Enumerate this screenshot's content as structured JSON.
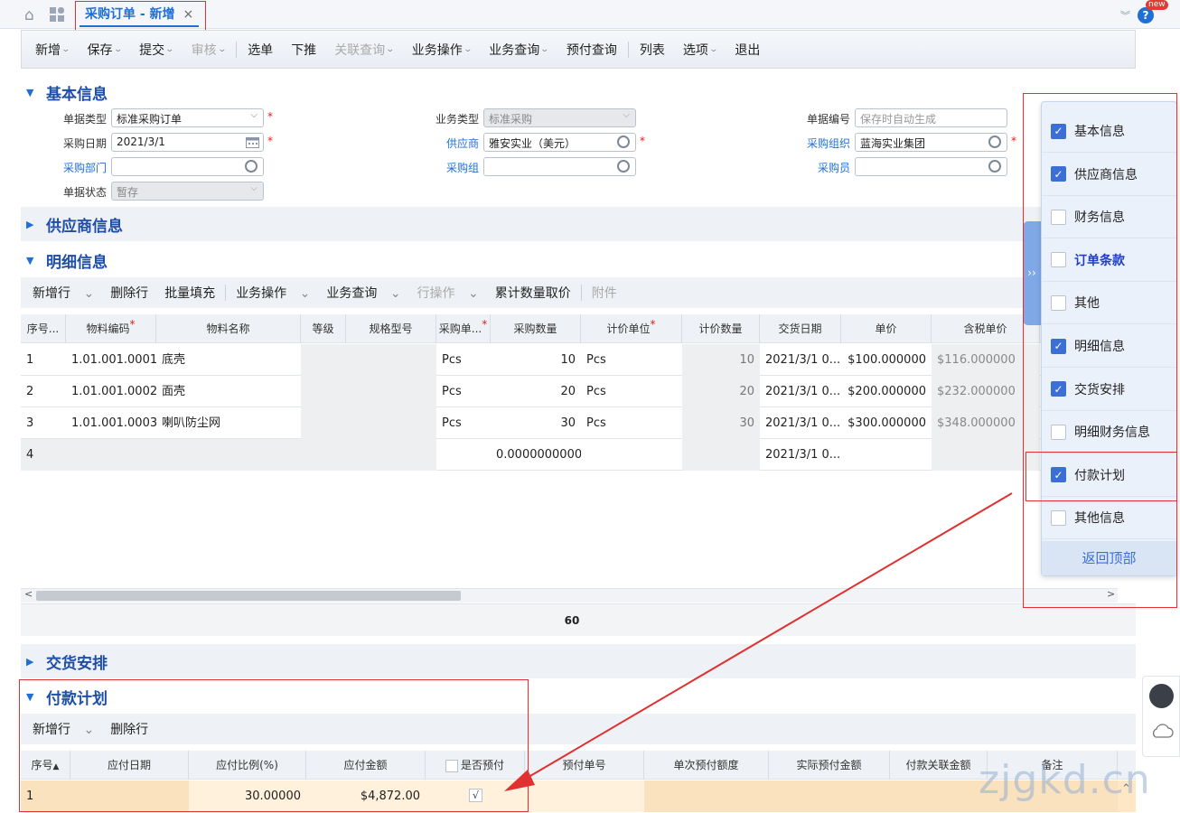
{
  "tab": {
    "title": "采购订单 - 新增",
    "close": "×"
  },
  "badge": "new",
  "toolbar": [
    "新增",
    "保存",
    "提交",
    "审核",
    "选单",
    "下推",
    "关联查询",
    "业务操作",
    "业务查询",
    "预付查询",
    "列表",
    "选项",
    "退出"
  ],
  "sections": {
    "basic": "基本信息",
    "supplier": "供应商信息",
    "detail": "明细信息",
    "delivery": "交货安排",
    "payment": "付款计划"
  },
  "form": {
    "bill_type_label": "单据类型",
    "bill_type": "标准采购订单",
    "biz_type_label": "业务类型",
    "biz_type": "标准采购",
    "bill_no_label": "单据编号",
    "bill_no_ph": "保存时自动生成",
    "date_label": "采购日期",
    "date": "2021/3/1",
    "supplier_label": "供应商",
    "supplier": "雅安实业（美元）",
    "org_label": "采购组织",
    "org": "蓝海实业集团",
    "dept_label": "采购部门",
    "group_label": "采购组",
    "buyer_label": "采购员",
    "status_label": "单据状态",
    "status": "暂存"
  },
  "detail_toolbar": [
    "新增行",
    "删除行",
    "批量填充",
    "业务操作",
    "业务查询",
    "行操作",
    "累计数量取价",
    "附件"
  ],
  "detail_headers": [
    "序号...",
    "物料编码",
    "物料名称",
    "等级",
    "规格型号",
    "采购单...",
    "采购数量",
    "计价单位",
    "计价数量",
    "交货日期",
    "单价",
    "含税单价"
  ],
  "detail_rows": [
    {
      "no": "1",
      "code": "1.01.001.0001",
      "name": "底壳",
      "unit": "Pcs",
      "qty": "10",
      "punit": "Pcs",
      "pqty": "10",
      "date": "2021/3/1 0...",
      "price": "$100.000000",
      "tprice": "$116.000000"
    },
    {
      "no": "2",
      "code": "1.01.001.0002",
      "name": "面壳",
      "unit": "Pcs",
      "qty": "20",
      "punit": "Pcs",
      "pqty": "20",
      "date": "2021/3/1 0...",
      "price": "$200.000000",
      "tprice": "$232.000000"
    },
    {
      "no": "3",
      "code": "1.01.001.0003",
      "name": "喇叭防尘网",
      "unit": "Pcs",
      "qty": "30",
      "punit": "Pcs",
      "pqty": "30",
      "date": "2021/3/1 0...",
      "price": "$300.000000",
      "tprice": "$348.000000"
    },
    {
      "no": "4",
      "code": "",
      "name": "",
      "unit": "",
      "qty": "0.0000000000",
      "punit": "",
      "pqty": "",
      "date": "2021/3/1 0...",
      "price": "",
      "tprice": ""
    }
  ],
  "detail_total": "60",
  "payment_toolbar": [
    "新增行",
    "删除行"
  ],
  "payment_headers": [
    "序号",
    "应付日期",
    "应付比例(%)",
    "应付金额",
    "是否预付",
    "预付单号",
    "单次预付额度",
    "实际预付金额",
    "付款关联金额",
    "备注"
  ],
  "payment_row": {
    "no": "1",
    "ratio": "30.00000",
    "amount": "$4,872.00",
    "prepay": "√"
  },
  "panel": {
    "items": [
      {
        "label": "基本信息",
        "checked": true
      },
      {
        "label": "供应商信息",
        "checked": true
      },
      {
        "label": "财务信息",
        "checked": false
      },
      {
        "label": "订单条款",
        "checked": false
      },
      {
        "label": "其他",
        "checked": false
      },
      {
        "label": "明细信息",
        "checked": true
      },
      {
        "label": "交货安排",
        "checked": true
      },
      {
        "label": "明细财务信息",
        "checked": false
      },
      {
        "label": "付款计划",
        "checked": true
      },
      {
        "label": "其他信息",
        "checked": false
      }
    ],
    "back": "返回顶部"
  },
  "watermark": "zjgkd.cn",
  "colors": {
    "accent": "#1f6fd6",
    "highlight": "#fde7c4",
    "annotation": "#e03030"
  }
}
